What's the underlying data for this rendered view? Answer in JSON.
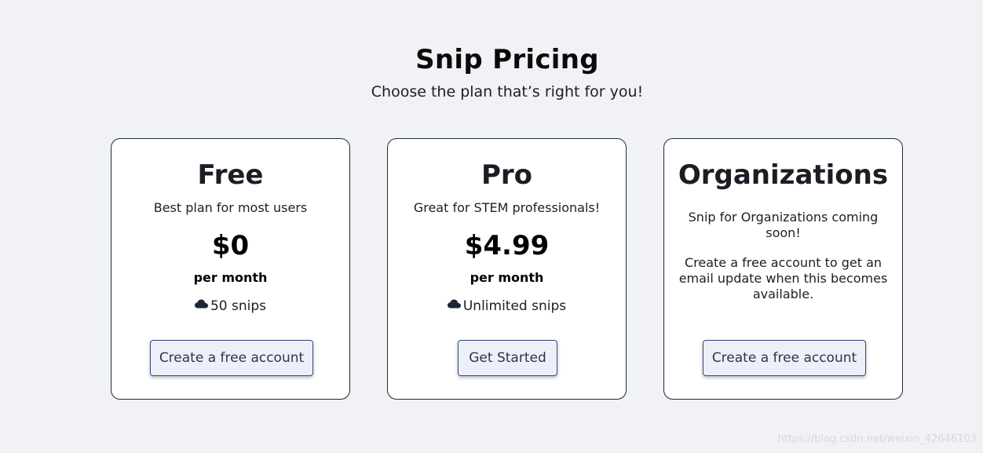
{
  "header": {
    "title": "Snip Pricing",
    "subtitle": "Choose the plan that’s right for you!"
  },
  "plans": [
    {
      "name": "Free",
      "description": "Best plan for most users",
      "price": "$0",
      "period": "per month",
      "feature": "50 snips",
      "feature_icon": "cloud-icon",
      "button_label": "Create a free account"
    },
    {
      "name": "Pro",
      "description": "Great for STEM professionals!",
      "price": "$4.99",
      "period": "per month",
      "feature": "Unlimited snips",
      "feature_icon": "cloud-icon",
      "button_label": "Get Started"
    },
    {
      "name": "Organizations",
      "note_1": "Snip for Organizations coming soon!",
      "note_2": "Create a free account to get an email update when this becomes available.",
      "button_label": "Create a free account"
    }
  ],
  "watermark": "https://blog.csdn.net/weixin_42646103",
  "colors": {
    "page_background": "#f0f2f6",
    "card_background": "#ffffff",
    "card_border": "#1f2937",
    "button_background": "#edf0f8",
    "button_border": "#3a4a7a",
    "icon_color": "#1c2636"
  }
}
